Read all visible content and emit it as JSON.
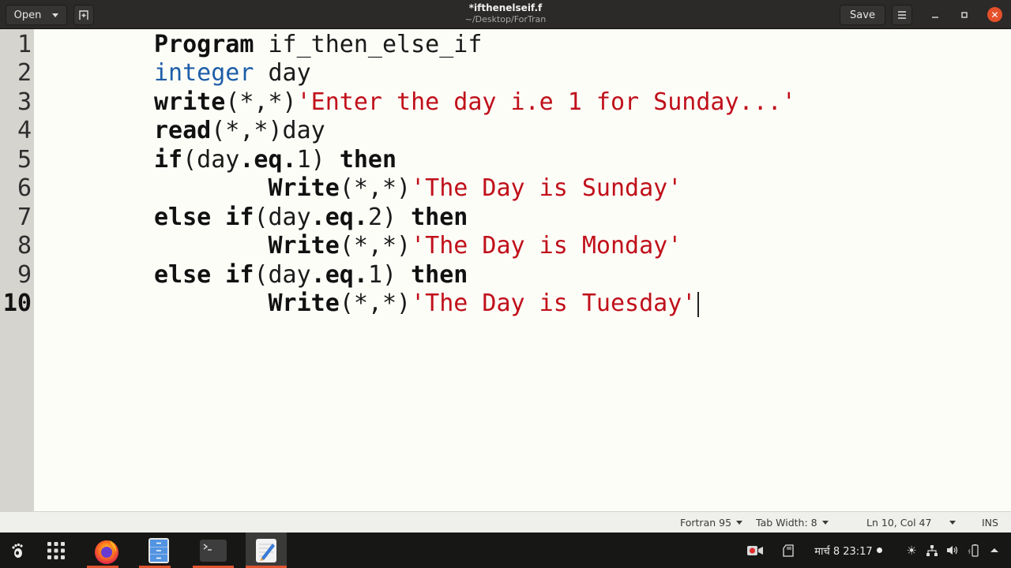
{
  "window": {
    "title": "*ifthenelseif.f",
    "subtitle": "~/Desktop/ForTran",
    "open_label": "Open",
    "save_label": "Save"
  },
  "editor": {
    "lines": [
      {
        "num": "1",
        "tokens": [
          {
            "t": "Program",
            "c": "kw"
          },
          {
            "t": " if_then_else_if",
            "c": ""
          }
        ]
      },
      {
        "num": "2",
        "tokens": [
          {
            "t": "integer",
            "c": "type"
          },
          {
            "t": " day",
            "c": ""
          }
        ]
      },
      {
        "num": "3",
        "tokens": [
          {
            "t": "write",
            "c": "kw"
          },
          {
            "t": "(*,*)",
            "c": ""
          },
          {
            "t": "'Enter the day i.e 1 for Sunday...'",
            "c": "str"
          }
        ]
      },
      {
        "num": "4",
        "tokens": [
          {
            "t": "read",
            "c": "kw"
          },
          {
            "t": "(*,*)day",
            "c": ""
          }
        ]
      },
      {
        "num": "5",
        "tokens": [
          {
            "t": "if",
            "c": "kw"
          },
          {
            "t": "(day",
            "c": ""
          },
          {
            "t": ".eq.",
            "c": "kw"
          },
          {
            "t": "1) ",
            "c": ""
          },
          {
            "t": "then",
            "c": "kw"
          }
        ]
      },
      {
        "num": "6",
        "tokens": [
          {
            "t": "        ",
            "c": ""
          },
          {
            "t": "Write",
            "c": "kw"
          },
          {
            "t": "(*,*)",
            "c": ""
          },
          {
            "t": "'The Day is Sunday'",
            "c": "str"
          }
        ]
      },
      {
        "num": "7",
        "tokens": [
          {
            "t": "else if",
            "c": "kw"
          },
          {
            "t": "(day",
            "c": ""
          },
          {
            "t": ".eq.",
            "c": "kw"
          },
          {
            "t": "2) ",
            "c": ""
          },
          {
            "t": "then",
            "c": "kw"
          }
        ]
      },
      {
        "num": "8",
        "tokens": [
          {
            "t": "        ",
            "c": ""
          },
          {
            "t": "Write",
            "c": "kw"
          },
          {
            "t": "(*,*)",
            "c": ""
          },
          {
            "t": "'The Day is Monday'",
            "c": "str"
          }
        ]
      },
      {
        "num": "9",
        "tokens": [
          {
            "t": "else if",
            "c": "kw"
          },
          {
            "t": "(day",
            "c": ""
          },
          {
            "t": ".eq.",
            "c": "kw"
          },
          {
            "t": "1) ",
            "c": ""
          },
          {
            "t": "then",
            "c": "kw"
          }
        ]
      },
      {
        "num": "10",
        "tokens": [
          {
            "t": "        ",
            "c": ""
          },
          {
            "t": "Write",
            "c": "kw"
          },
          {
            "t": "(*,*)",
            "c": ""
          },
          {
            "t": "'The Day is Tuesday'",
            "c": "str"
          }
        ],
        "current": true
      }
    ]
  },
  "statusbar": {
    "language": "Fortran 95",
    "tab_width": "Tab Width: 8",
    "position": "Ln 10, Col 47",
    "mode": "INS"
  },
  "taskbar": {
    "apps": [
      "firefox",
      "files",
      "terminal",
      "text-editor"
    ],
    "clock": "मार्च 8  23:17"
  },
  "colors": {
    "keyword_type": "#1e5ea8",
    "string": "#c0101a",
    "close_button": "#e5502b",
    "running_indicator": "#e0542d"
  }
}
